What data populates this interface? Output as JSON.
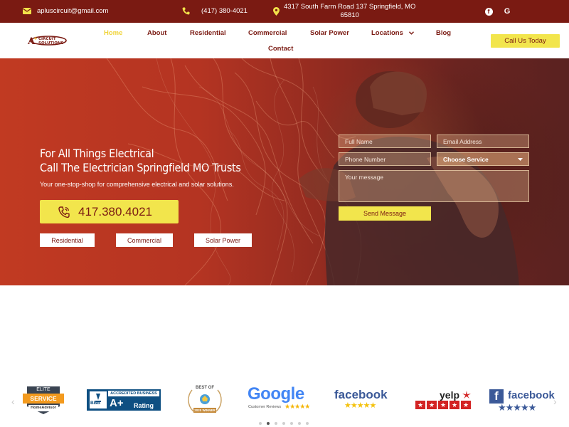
{
  "topbar": {
    "email": "apluscircuit@gmail.com",
    "phone": "(417) 380-4021",
    "address_line1": "4317 South Farm Road 137 Springfield, MO",
    "address_line2": "65810",
    "email_icon": "envelope-icon",
    "phone_icon": "phone-icon",
    "address_icon": "map-pin-icon",
    "social": [
      "facebook-icon",
      "google-icon"
    ],
    "google_letter": "G",
    "facebook_letter": "f"
  },
  "logo": {
    "text": "A+ CIRCUIT SOLUTIONS"
  },
  "nav": {
    "items": [
      {
        "label": "Home",
        "active": true
      },
      {
        "label": "About"
      },
      {
        "label": "Residential"
      },
      {
        "label": "Commercial"
      },
      {
        "label": "Solar Power"
      },
      {
        "label": "Locations",
        "has_dropdown": true
      },
      {
        "label": "Blog"
      },
      {
        "label": "Contact"
      }
    ],
    "cta_label": "Call Us Today"
  },
  "hero": {
    "title_line1": "For All Things Electrical",
    "title_line2": "Call The Electrician Springfield MO Trusts",
    "subtitle": "Your one-stop-shop for comprehensive electrical and solar solutions.",
    "phone_button": "417.380.4021",
    "service_buttons": [
      "Residential",
      "Commercial",
      "Solar Power"
    ]
  },
  "form": {
    "full_name_placeholder": "Full Name",
    "email_placeholder": "Email Address",
    "phone_placeholder": "Phone Number",
    "service_select": "Choose Service",
    "message_placeholder": "Your message",
    "submit_label": "Send Message"
  },
  "badges": {
    "elite": {
      "top": "ELITE",
      "middle": "SERVICE",
      "bottom": "HomeAdvisor"
    },
    "bbb": {
      "top": "ACCREDITED BUSINESS",
      "bbb": "BBB",
      "grade": "A+",
      "rating": "Rating"
    },
    "best_of": {
      "top": "BEST OF",
      "bottom": "2020 WINNER"
    },
    "google": {
      "word": "Google",
      "sub": "Customer Reviews",
      "stars": "★★★★★"
    },
    "facebook1": {
      "word": "facebook",
      "stars": "★★★★★"
    },
    "yelp": {
      "word": "yelp",
      "stars": "★★★★★"
    },
    "facebook2": {
      "word": "facebook",
      "stars": "★★★★★",
      "letter": "f"
    }
  },
  "carousel": {
    "dot_count": 7,
    "active_dot": 1,
    "prev_label": "‹",
    "next_label": "›"
  },
  "colors": {
    "brand": "#7a1a12",
    "accent": "#f2e54c"
  }
}
